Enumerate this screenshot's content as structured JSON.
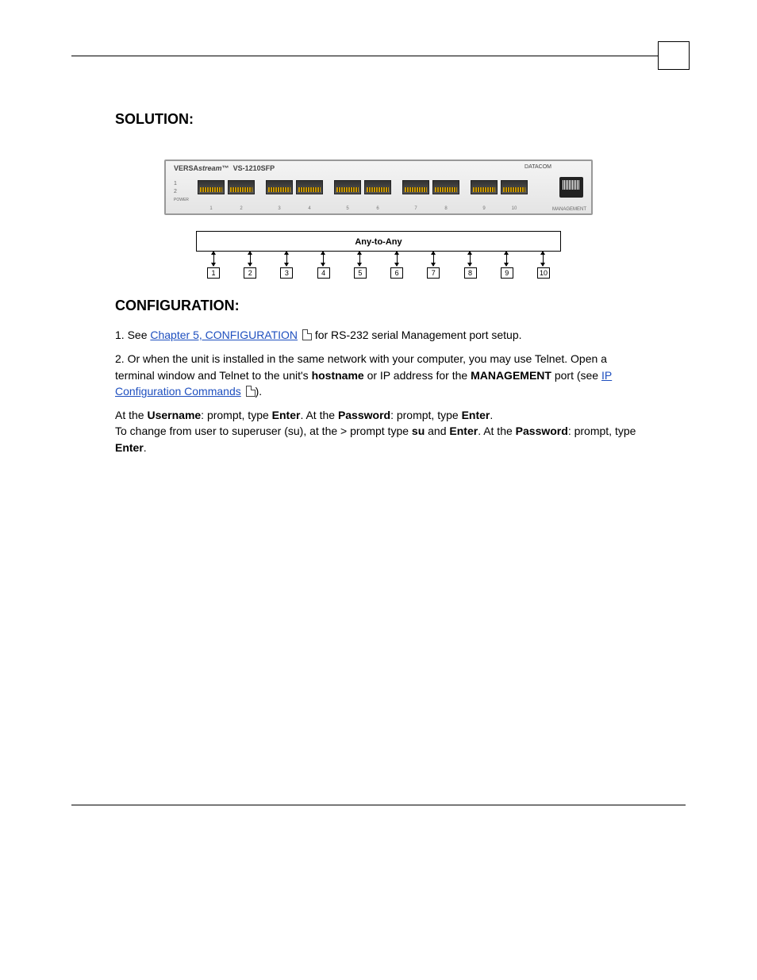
{
  "headings": {
    "solution": "SOLUTION:",
    "configuration": "CONFIGURATION:"
  },
  "device": {
    "brand_prefix": "VERSA",
    "brand_italic": "stream",
    "brand_tm": "™",
    "model": "VS-1210SFP",
    "logo_text": "DATACOM",
    "mgmt_label": "MANAGEMENT",
    "power_label": "POWER",
    "leds": [
      "1",
      "2"
    ],
    "port_numbers": [
      "1",
      "2",
      "3",
      "4",
      "5",
      "6",
      "7",
      "8",
      "9",
      "10"
    ]
  },
  "diagram": {
    "box_label": "Any-to-Any",
    "ports": [
      "1",
      "2",
      "3",
      "4",
      "5",
      "6",
      "7",
      "8",
      "9",
      "10"
    ]
  },
  "para_config_1_pre": "1. See ",
  "para_config_1_link": "Chapter 5, CONFIGURATION",
  "para_config_1_post": " for RS-232 serial Management port setup.",
  "para_config_2_a": "2. Or when the unit is installed in the same network with your computer, you may use Telnet. Open a terminal window and Telnet to the unit's ",
  "para_config_2_hostname": "hostname",
  "para_config_2_b": " or IP address for the ",
  "para_config_2_mgmt": "MANAGEMENT",
  "para_config_2_c": " port (see ",
  "para_config_2_link": "IP Configuration Commands",
  "para_config_2_d": ").",
  "para_login_a": "At the ",
  "para_login_user": "Username",
  "para_login_b": ": prompt, type ",
  "para_login_enter1": "Enter",
  "para_login_c": ". At the ",
  "para_login_pass": "Password",
  "para_login_d": ": prompt, type ",
  "para_login_enter2": "Enter",
  "para_login_e": ".",
  "para_su_a": "To change from user to superuser (su), at the > prompt type ",
  "para_su_su": "su",
  "para_su_b": " and ",
  "para_su_enter": "Enter",
  "para_su_c": ". At the ",
  "para_su_pass": "Password",
  "para_su_d": ": prompt, type ",
  "para_su_enter2": "Enter",
  "para_su_e": "."
}
